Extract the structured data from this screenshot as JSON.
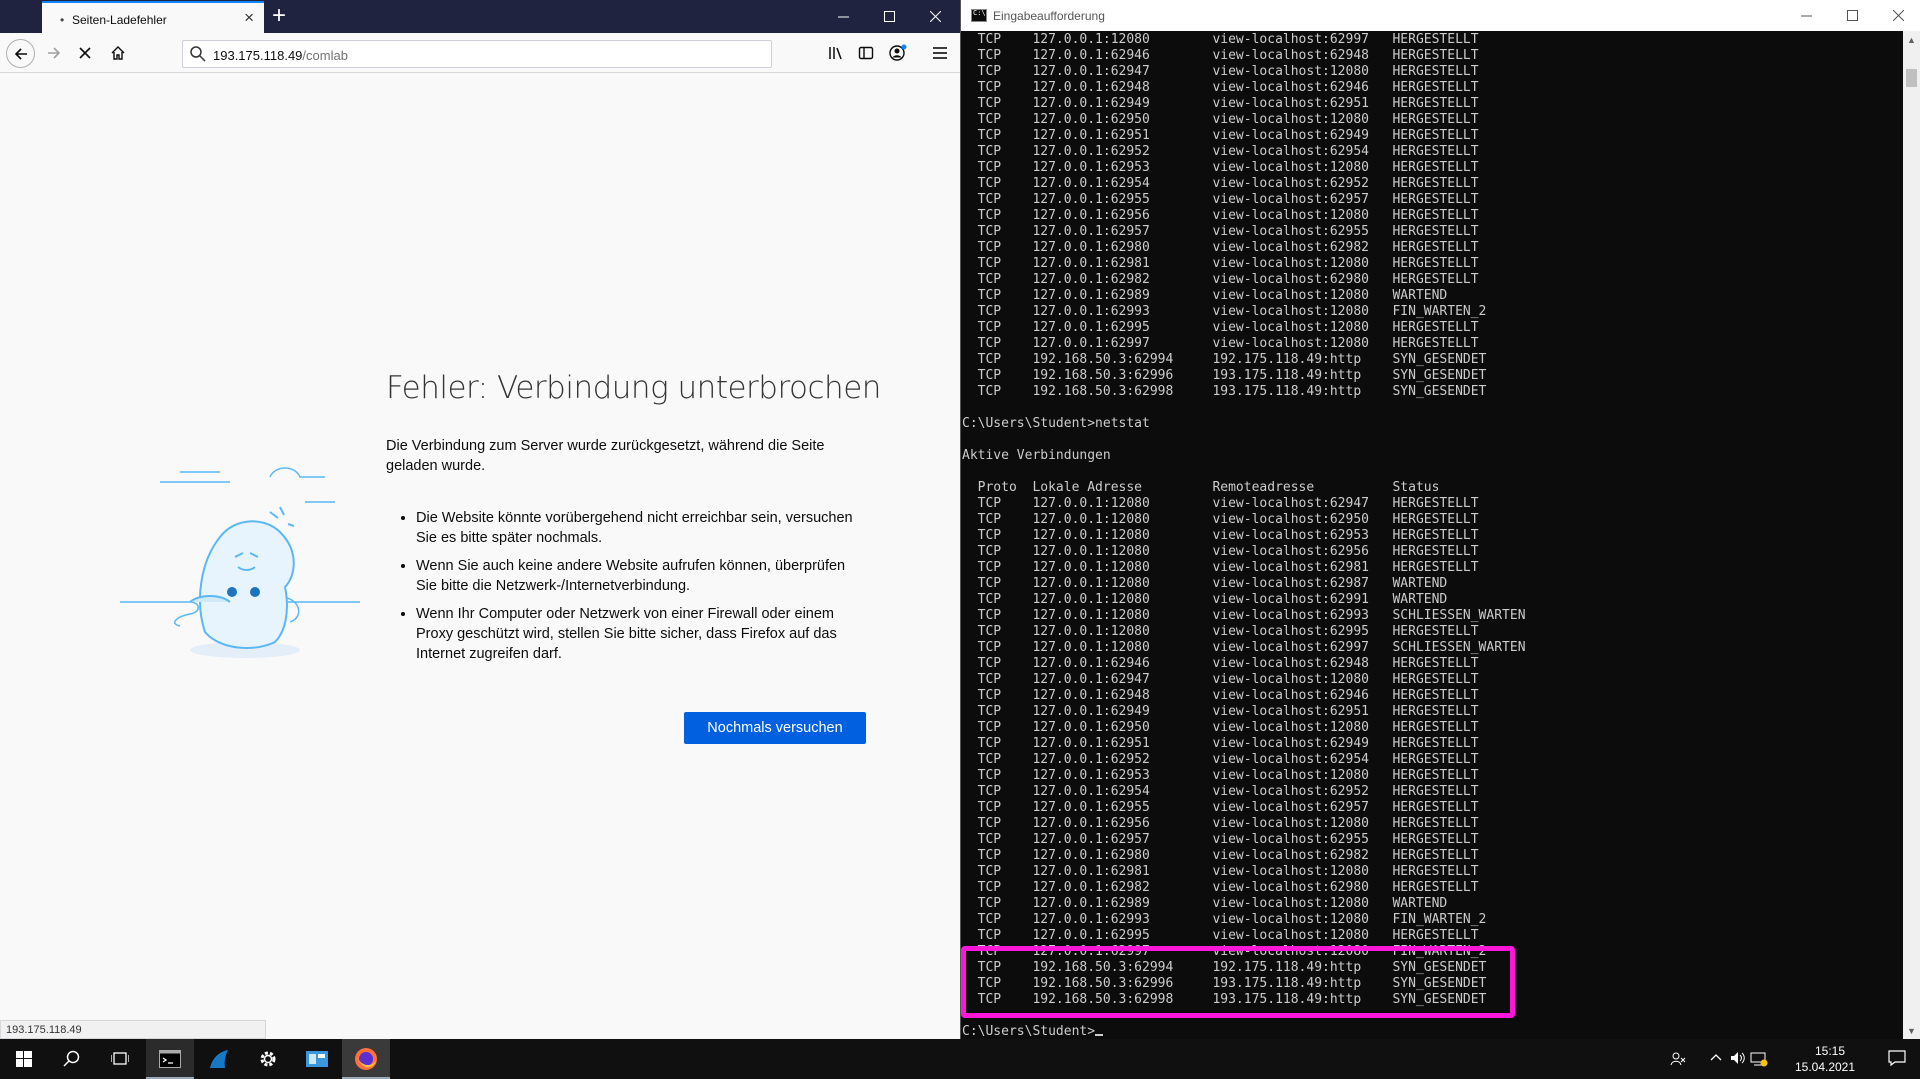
{
  "firefox": {
    "tab_title": "Seiten-Ladefehler",
    "tab_close": "×",
    "new_tab": "+",
    "url_host": "193.175.118.49",
    "url_path": "/comlab",
    "error_title": "Fehler: Verbindung unterbrochen",
    "error_description": "Die Verbindung zum Server wurde zurückgesetzt, während die Seite geladen wurde.",
    "error_items": [
      "Die Website könnte vorübergehend nicht erreichbar sein, versuchen Sie es bitte später nochmals.",
      "Wenn Sie auch keine andere Website aufrufen können, überprüfen Sie bitte die Netzwerk-/Internetverbindung.",
      "Wenn Ihr Computer oder Netzwerk von einer Firewall oder einem Proxy geschützt wird, stellen Sie bitte sicher, dass Firefox auf das Internet zugreifen darf."
    ],
    "retry_button": "Nochmals versuchen",
    "status_url": "193.175.118.49"
  },
  "cmd": {
    "title": "Eingabeaufforderung",
    "lines": [
      "  TCP    127.0.0.1:12080        view-localhost:62997   HERGESTELLT",
      "  TCP    127.0.0.1:62946        view-localhost:62948   HERGESTELLT",
      "  TCP    127.0.0.1:62947        view-localhost:12080   HERGESTELLT",
      "  TCP    127.0.0.1:62948        view-localhost:62946   HERGESTELLT",
      "  TCP    127.0.0.1:62949        view-localhost:62951   HERGESTELLT",
      "  TCP    127.0.0.1:62950        view-localhost:12080   HERGESTELLT",
      "  TCP    127.0.0.1:62951        view-localhost:62949   HERGESTELLT",
      "  TCP    127.0.0.1:62952        view-localhost:62954   HERGESTELLT",
      "  TCP    127.0.0.1:62953        view-localhost:12080   HERGESTELLT",
      "  TCP    127.0.0.1:62954        view-localhost:62952   HERGESTELLT",
      "  TCP    127.0.0.1:62955        view-localhost:62957   HERGESTELLT",
      "  TCP    127.0.0.1:62956        view-localhost:12080   HERGESTELLT",
      "  TCP    127.0.0.1:62957        view-localhost:62955   HERGESTELLT",
      "  TCP    127.0.0.1:62980        view-localhost:62982   HERGESTELLT",
      "  TCP    127.0.0.1:62981        view-localhost:12080   HERGESTELLT",
      "  TCP    127.0.0.1:62982        view-localhost:62980   HERGESTELLT",
      "  TCP    127.0.0.1:62989        view-localhost:12080   WARTEND",
      "  TCP    127.0.0.1:62993        view-localhost:12080   FIN_WARTEN_2",
      "  TCP    127.0.0.1:62995        view-localhost:12080   HERGESTELLT",
      "  TCP    127.0.0.1:62997        view-localhost:12080   HERGESTELLT",
      "  TCP    192.168.50.3:62994     192.175.118.49:http    SYN_GESENDET",
      "  TCP    192.168.50.3:62996     193.175.118.49:http    SYN_GESENDET",
      "  TCP    192.168.50.3:62998     193.175.118.49:http    SYN_GESENDET",
      "",
      "C:\\Users\\Student>netstat",
      "",
      "Aktive Verbindungen",
      "",
      "  Proto  Lokale Adresse         Remoteadresse          Status",
      "  TCP    127.0.0.1:12080        view-localhost:62947   HERGESTELLT",
      "  TCP    127.0.0.1:12080        view-localhost:62950   HERGESTELLT",
      "  TCP    127.0.0.1:12080        view-localhost:62953   HERGESTELLT",
      "  TCP    127.0.0.1:12080        view-localhost:62956   HERGESTELLT",
      "  TCP    127.0.0.1:12080        view-localhost:62981   HERGESTELLT",
      "  TCP    127.0.0.1:12080        view-localhost:62987   WARTEND",
      "  TCP    127.0.0.1:12080        view-localhost:62991   WARTEND",
      "  TCP    127.0.0.1:12080        view-localhost:62993   SCHLIESSEN_WARTEN",
      "  TCP    127.0.0.1:12080        view-localhost:62995   HERGESTELLT",
      "  TCP    127.0.0.1:12080        view-localhost:62997   SCHLIESSEN_WARTEN",
      "  TCP    127.0.0.1:62946        view-localhost:62948   HERGESTELLT",
      "  TCP    127.0.0.1:62947        view-localhost:12080   HERGESTELLT",
      "  TCP    127.0.0.1:62948        view-localhost:62946   HERGESTELLT",
      "  TCP    127.0.0.1:62949        view-localhost:62951   HERGESTELLT",
      "  TCP    127.0.0.1:62950        view-localhost:12080   HERGESTELLT",
      "  TCP    127.0.0.1:62951        view-localhost:62949   HERGESTELLT",
      "  TCP    127.0.0.1:62952        view-localhost:62954   HERGESTELLT",
      "  TCP    127.0.0.1:62953        view-localhost:12080   HERGESTELLT",
      "  TCP    127.0.0.1:62954        view-localhost:62952   HERGESTELLT",
      "  TCP    127.0.0.1:62955        view-localhost:62957   HERGESTELLT",
      "  TCP    127.0.0.1:62956        view-localhost:12080   HERGESTELLT",
      "  TCP    127.0.0.1:62957        view-localhost:62955   HERGESTELLT",
      "  TCP    127.0.0.1:62980        view-localhost:62982   HERGESTELLT",
      "  TCP    127.0.0.1:62981        view-localhost:12080   HERGESTELLT",
      "  TCP    127.0.0.1:62982        view-localhost:62980   HERGESTELLT",
      "  TCP    127.0.0.1:62989        view-localhost:12080   WARTEND",
      "  TCP    127.0.0.1:62993        view-localhost:12080   FIN_WARTEN_2",
      "  TCP    127.0.0.1:62995        view-localhost:12080   HERGESTELLT",
      "  TCP    127.0.0.1:62997        view-localhost:12080   FIN_WARTEN_2",
      "  TCP    192.168.50.3:62994     192.175.118.49:http    SYN_GESENDET",
      "  TCP    192.168.50.3:62996     193.175.118.49:http    SYN_GESENDET",
      "  TCP    192.168.50.3:62998     193.175.118.49:http    SYN_GESENDET",
      "",
      "C:\\Users\\Student>"
    ],
    "highlight_color": "#ff17d9"
  },
  "taskbar": {
    "time": "15:15",
    "date": "15.04.2021",
    "icons": [
      "windows-icon",
      "search-icon",
      "task-view-icon",
      "cmd-icon",
      "wireshark-icon",
      "settings-icon",
      "app-icon",
      "firefox-icon"
    ]
  },
  "colors": {
    "firefox_title_bg": "#202340",
    "retry_button_bg": "#0060df",
    "cmd_bg": "#0c0c0c",
    "cmd_text": "#cccccc",
    "taskbar_bg": "#101010"
  }
}
